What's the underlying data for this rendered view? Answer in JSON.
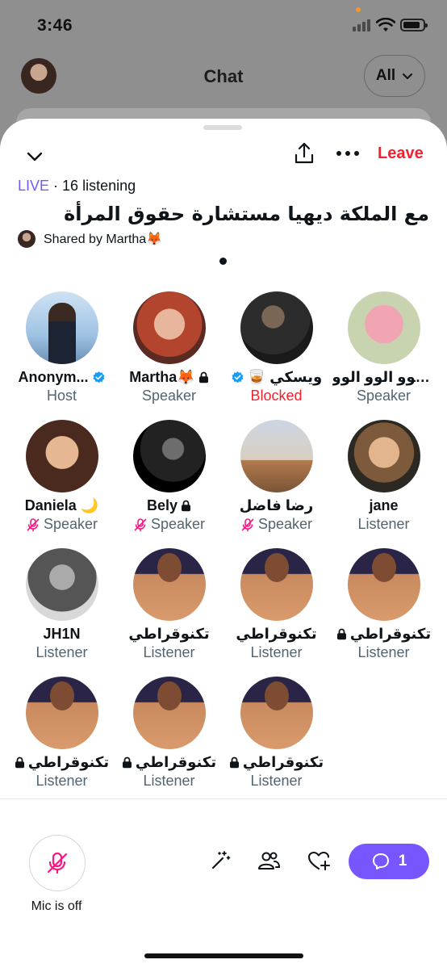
{
  "status": {
    "time": "3:46"
  },
  "header": {
    "title": "Chat",
    "filter_label": "All"
  },
  "sheet": {
    "leave_label": "Leave",
    "live_label": "LIVE",
    "listening_text": "· 16 listening",
    "space_title": "مع الملكة ديهيا مستشارة حقوق المرأة",
    "shared_by": "Shared by Martha🦊"
  },
  "participants": [
    {
      "name": "Anonym...",
      "role": "Host",
      "verified": true,
      "lock": false,
      "muted": false,
      "blocked": false,
      "avatar": "av-1"
    },
    {
      "name": "Martha🦊",
      "role": "Speaker",
      "verified": false,
      "lock": true,
      "muted": false,
      "blocked": false,
      "avatar": "av-2"
    },
    {
      "name": "🥃 ويسكي",
      "role": "Blocked",
      "verified": true,
      "lock": false,
      "muted": false,
      "blocked": true,
      "avatar": "av-3"
    },
    {
      "name": "الوو الوو الوو...",
      "role": "Speaker",
      "verified": false,
      "lock": false,
      "muted": false,
      "blocked": false,
      "avatar": "av-4"
    },
    {
      "name": "Daniela 🌙",
      "role": "Speaker",
      "verified": false,
      "lock": false,
      "muted": true,
      "blocked": false,
      "avatar": "av-5"
    },
    {
      "name": "Bely",
      "role": "Speaker",
      "verified": false,
      "lock": true,
      "muted": true,
      "blocked": false,
      "avatar": "av-6"
    },
    {
      "name": "رضا فاضل",
      "role": "Speaker",
      "verified": false,
      "lock": false,
      "muted": true,
      "blocked": false,
      "avatar": "av-7"
    },
    {
      "name": "jane",
      "role": "Listener",
      "verified": false,
      "lock": false,
      "muted": false,
      "blocked": false,
      "avatar": "av-8"
    },
    {
      "name": "JH1N",
      "role": "Listener",
      "verified": false,
      "lock": false,
      "muted": false,
      "blocked": false,
      "avatar": "av-9"
    },
    {
      "name": "تكنوقراطي",
      "role": "Listener",
      "verified": false,
      "lock": false,
      "muted": false,
      "blocked": false,
      "avatar": "av-td"
    },
    {
      "name": "تكنوقراطي",
      "role": "Listener",
      "verified": false,
      "lock": false,
      "muted": false,
      "blocked": false,
      "avatar": "av-td"
    },
    {
      "name": "تكنوقراطي",
      "role": "Listener",
      "verified": false,
      "lock": true,
      "muted": false,
      "blocked": false,
      "avatar": "av-td"
    },
    {
      "name": "تكنوقراطي",
      "role": "Listener",
      "verified": false,
      "lock": true,
      "muted": false,
      "blocked": false,
      "avatar": "av-td"
    },
    {
      "name": "تكنوقراطي",
      "role": "Listener",
      "verified": false,
      "lock": true,
      "muted": false,
      "blocked": false,
      "avatar": "av-td"
    },
    {
      "name": "تكنوقراطي",
      "role": "Listener",
      "verified": false,
      "lock": true,
      "muted": false,
      "blocked": false,
      "avatar": "av-td"
    }
  ],
  "bottom": {
    "mic_label": "Mic is off",
    "chat_count": "1"
  },
  "colors": {
    "accent": "#7856ff",
    "leave": "#f4212e",
    "mute": "#f91880",
    "verified": "#1d9bf0"
  }
}
